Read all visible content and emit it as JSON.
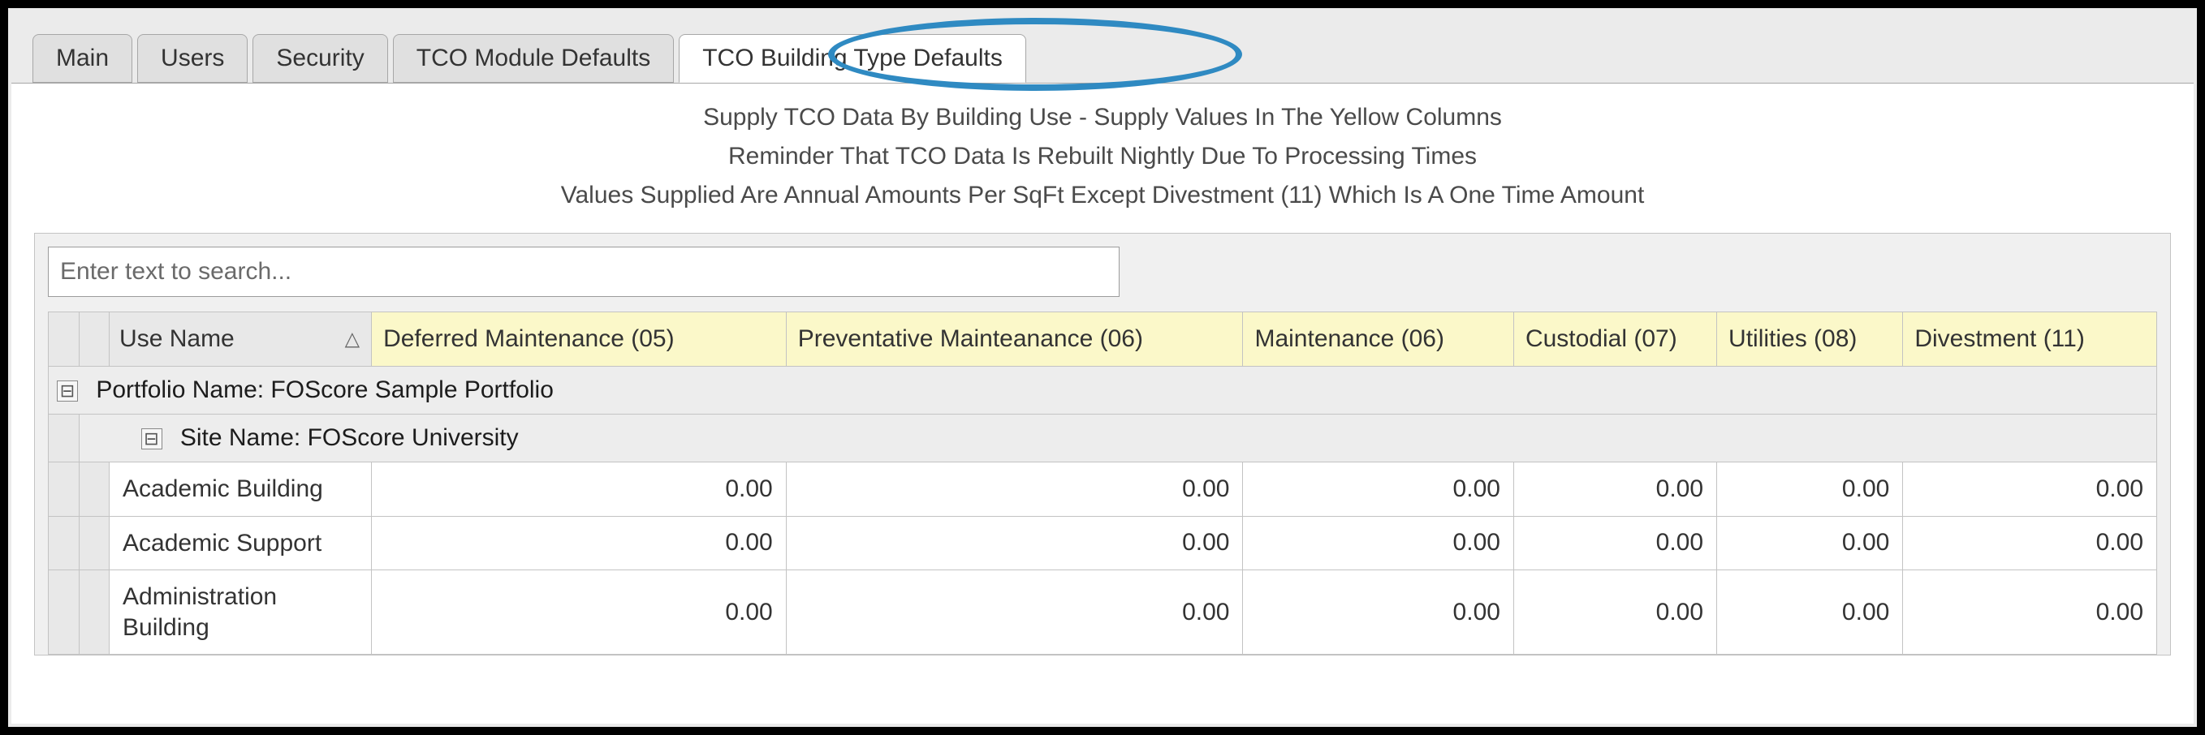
{
  "tabs": [
    {
      "label": "Main",
      "active": false
    },
    {
      "label": "Users",
      "active": false
    },
    {
      "label": "Security",
      "active": false
    },
    {
      "label": "TCO Module Defaults",
      "active": false
    },
    {
      "label": "TCO Building Type Defaults",
      "active": true
    }
  ],
  "instructions": {
    "line1": "Supply TCO Data By Building Use - Supply Values In The Yellow Columns",
    "line2": "Reminder That TCO Data Is Rebuilt Nightly Due To Processing Times",
    "line3": "Values Supplied Are Annual Amounts Per SqFt Except Divestment (11) Which Is A One Time Amount"
  },
  "search": {
    "placeholder": "Enter text to search..."
  },
  "columns": {
    "use_name": "Use Name",
    "deferred": "Deferred Maintenance (05)",
    "preventative": "Preventative Mainteanance (06)",
    "maintenance": "Maintenance (06)",
    "custodial": "Custodial (07)",
    "utilities": "Utilities (08)",
    "divestment": "Divestment (11)"
  },
  "group1": {
    "label": "Portfolio Name: FOScore Sample Portfolio"
  },
  "group2": {
    "label": "Site Name: FOScore University"
  },
  "rows": [
    {
      "use": "Academic Building",
      "dm": "0.00",
      "pm": "0.00",
      "m": "0.00",
      "c": "0.00",
      "u": "0.00",
      "dv": "0.00"
    },
    {
      "use": "Academic Support",
      "dm": "0.00",
      "pm": "0.00",
      "m": "0.00",
      "c": "0.00",
      "u": "0.00",
      "dv": "0.00"
    },
    {
      "use": "Administration Building",
      "dm": "0.00",
      "pm": "0.00",
      "m": "0.00",
      "c": "0.00",
      "u": "0.00",
      "dv": "0.00"
    }
  ],
  "glyphs": {
    "collapse": "⊟",
    "sort": "△"
  }
}
